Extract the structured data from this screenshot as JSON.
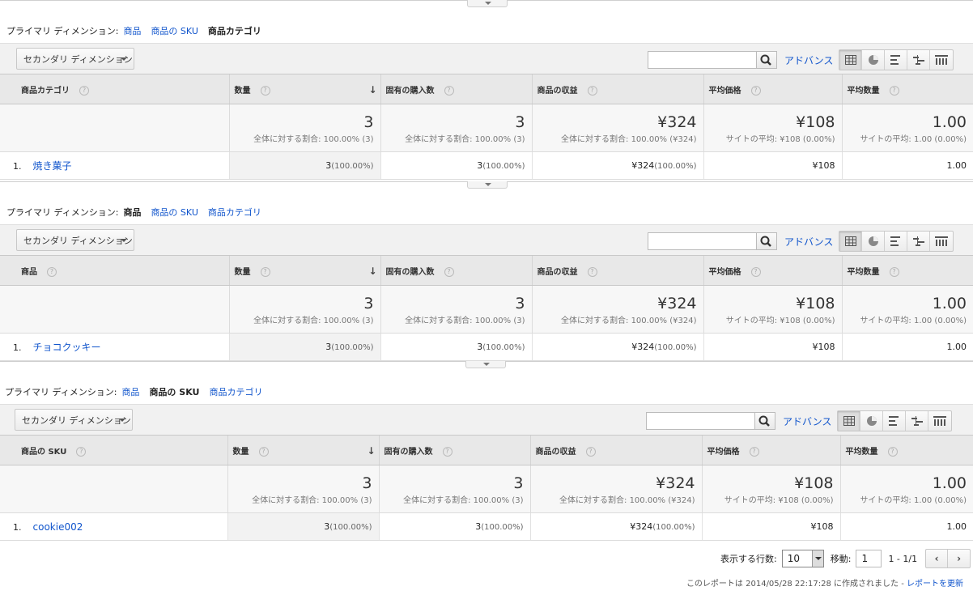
{
  "dim_label": "プライマリ ディメンション:",
  "dim_options": [
    "商品",
    "商品の SKU",
    "商品カテゴリ"
  ],
  "secondary_dimension": "セカンダリ ディメンション",
  "advanced": "アドバンス",
  "columns": [
    "数量",
    "固有の購入数",
    "商品の収益",
    "平均価格",
    "平均数量"
  ],
  "totals": {
    "qty": "3",
    "qty_sub": "全体に対する割合: 100.00% (3)",
    "uniq": "3",
    "uniq_sub": "全体に対する割合: 100.00% (3)",
    "rev": "¥324",
    "rev_sub": "全体に対する割合: 100.00% (¥324)",
    "price": "¥108",
    "price_sub": "サイトの平均: ¥108 (0.00%)",
    "avgqty": "1.00",
    "avgqty_sub": "サイトの平均: 1.00 (0.00%)"
  },
  "row_values": {
    "index": "1.",
    "qty": "3",
    "qty_pct": "(100.00%)",
    "uniq": "3",
    "uniq_pct": "(100.00%)",
    "rev": "¥324",
    "rev_pct": "(100.00%)",
    "price": "¥108",
    "avgqty": "1.00"
  },
  "tables": [
    {
      "dim_header": "商品カテゴリ",
      "row_label": "焼き菓子"
    },
    {
      "dim_header": "商品",
      "row_label": "チョコクッキー"
    },
    {
      "dim_header": "商品の SKU",
      "row_label": "cookie002"
    }
  ],
  "pager": {
    "rows_label": "表示する行数:",
    "rows_value": "10",
    "goto_label": "移動:",
    "goto_value": "1",
    "range": "1 - 1/1"
  },
  "report_note": "このレポートは 2014/05/28 22:17:28 に作成されました - ",
  "refresh_link": "レポートを更新"
}
